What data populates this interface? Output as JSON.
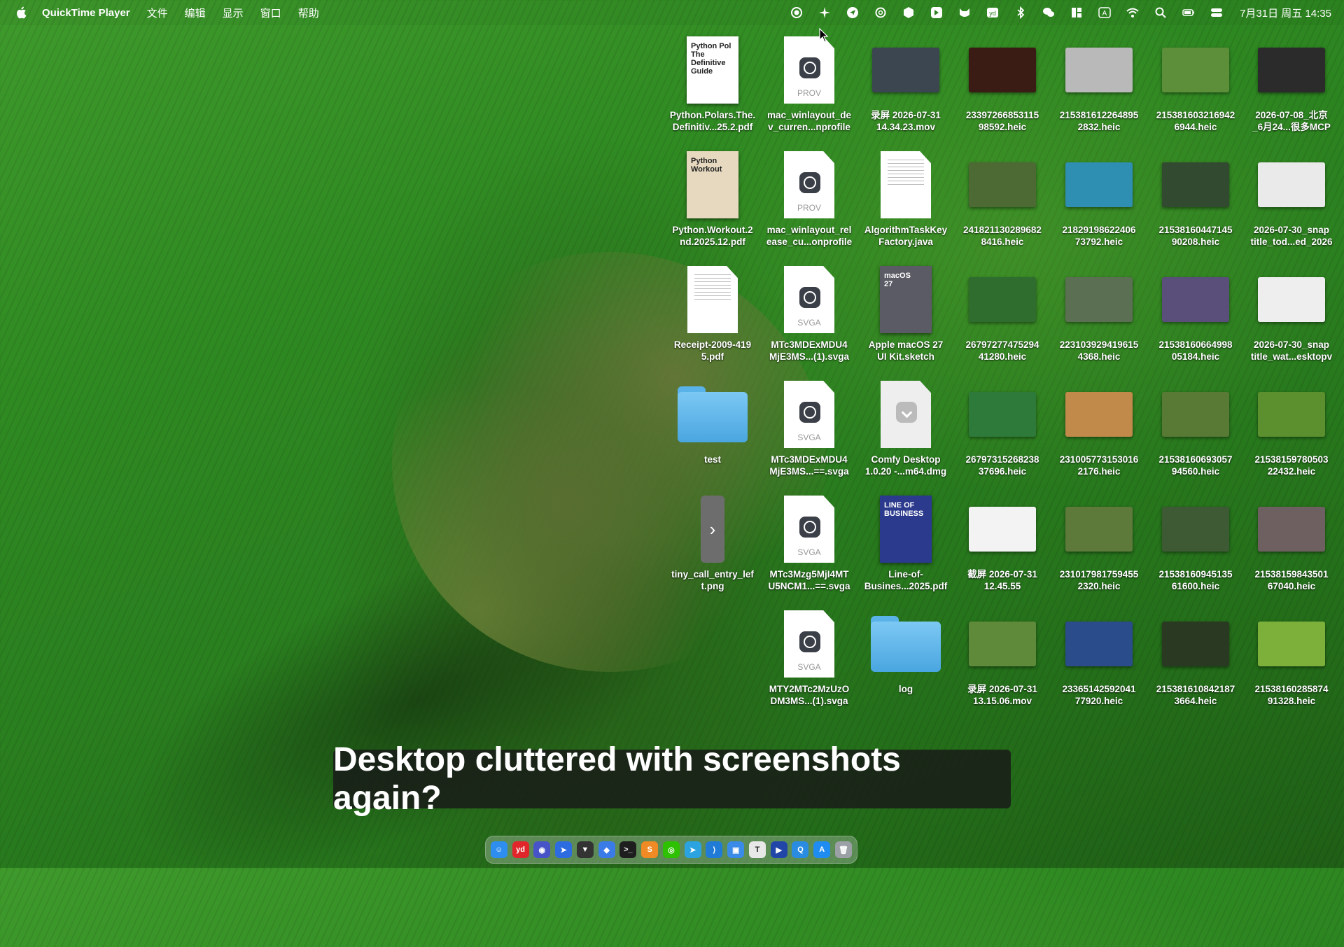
{
  "menubar": {
    "app_name": "QuickTime Player",
    "menus": [
      "文件",
      "编辑",
      "显示",
      "窗口",
      "帮助"
    ],
    "input_method": "A",
    "clock": "7月31日 周五  14:35"
  },
  "desktop_icons": [
    {
      "label": "Python.Polars.The.\nDefinitiv...25.2.pdf",
      "kind": "cover",
      "cover_title": "Python Pol\nThe Definitive Guide",
      "color": "#ffffff"
    },
    {
      "label": "mac_winlayout_de\nv_curren...nprofile",
      "kind": "doc-badge",
      "cap": "PROV"
    },
    {
      "label": "录屏 2026-07-31\n14.34.23.mov",
      "kind": "photo",
      "color": "#3b4650"
    },
    {
      "label": "23397266853115\n98592.heic",
      "kind": "photo",
      "color": "#3a1c14"
    },
    {
      "label": "215381612264895\n2832.heic",
      "kind": "photo",
      "color": "#b9b9b9"
    },
    {
      "label": "215381603216942\n6944.heic",
      "kind": "photo",
      "color": "#5d8f3a"
    },
    {
      "label": "2026-07-08_北京\n_6月24...很多MCP",
      "kind": "photo",
      "color": "#2b2b2b"
    },
    {
      "label": "Python.Workout.2\nnd.2025.12.pdf",
      "kind": "cover",
      "cover_title": "Python\nWorkout",
      "color": "#e7d9bf"
    },
    {
      "label": "mac_winlayout_rel\nease_cu...onprofile",
      "kind": "doc-badge",
      "cap": "PROV"
    },
    {
      "label": "AlgorithmTaskKey\nFactory.java",
      "kind": "doc-lines",
      "cap": ""
    },
    {
      "label": "241821130289682\n8416.heic",
      "kind": "photo",
      "color": "#4d6a34"
    },
    {
      "label": "21829198622406\n73792.heic",
      "kind": "photo",
      "color": "#2f8fb3"
    },
    {
      "label": "21538160447145\n90208.heic",
      "kind": "photo",
      "color": "#324a30"
    },
    {
      "label": "2026-07-30_snap\ntitle_tod...ed_2026",
      "kind": "photo",
      "color": "#eaeaea"
    },
    {
      "label": "Receipt-2009-419\n5.pdf",
      "kind": "doc-lines",
      "cap": ""
    },
    {
      "label": "MTc3MDExMDU4\nMjE3MS...(1).svga",
      "kind": "doc-badge",
      "cap": "SVGA"
    },
    {
      "label": "Apple macOS 27\nUI Kit.sketch",
      "kind": "cover",
      "cover_title": "macOS\n27",
      "color": "#5b5b66"
    },
    {
      "label": "26797277475294\n41280.heic",
      "kind": "photo",
      "color": "#2f6d2f"
    },
    {
      "label": "223103929419615\n4368.heic",
      "kind": "photo",
      "color": "#5b6f52"
    },
    {
      "label": "21538160664998\n05184.heic",
      "kind": "photo",
      "color": "#5a4f7a"
    },
    {
      "label": "2026-07-30_snap\ntitle_wat...esktopv",
      "kind": "photo",
      "color": "#eeeeee"
    },
    {
      "label": "test",
      "kind": "folder"
    },
    {
      "label": "MTc3MDExMDU4\nMjE3MS...==.svga",
      "kind": "doc-badge",
      "cap": "SVGA"
    },
    {
      "label": "Comfy Desktop\n1.0.20 -...m64.dmg",
      "kind": "doc-dmg",
      "cap": ""
    },
    {
      "label": "26797315268238\n37696.heic",
      "kind": "photo",
      "color": "#2e7a3a"
    },
    {
      "label": "231005773153016\n2176.heic",
      "kind": "photo",
      "color": "#c28a4a"
    },
    {
      "label": "21538160693057\n94560.heic",
      "kind": "photo",
      "color": "#597a35"
    },
    {
      "label": "21538159780503\n22432.heic",
      "kind": "photo",
      "color": "#5c8f2e"
    },
    {
      "label": "tiny_call_entry_lef\nt.png",
      "kind": "side-panel",
      "glyph": "›"
    },
    {
      "label": "MTc3Mzg5MjI4MT\nU5NCM1...==.svga",
      "kind": "doc-badge",
      "cap": "SVGA"
    },
    {
      "label": "Line-of-\nBusines...2025.pdf",
      "kind": "cover",
      "cover_title": "LINE OF\nBUSINESS",
      "color": "#2b3a8c"
    },
    {
      "label": "截屏 2026-07-31\n12.45.55",
      "kind": "photo",
      "color": "#f3f3f3"
    },
    {
      "label": "231017981759455\n2320.heic",
      "kind": "photo",
      "color": "#5d7a3a"
    },
    {
      "label": "21538160945135\n61600.heic",
      "kind": "photo",
      "color": "#3d5a35"
    },
    {
      "label": "21538159843501\n67040.heic",
      "kind": "photo",
      "color": "#6e6060"
    },
    {
      "label": "",
      "kind": "empty"
    },
    {
      "label": "MTY2MTc2MzUzO\nDM3MS...(1).svga",
      "kind": "doc-badge",
      "cap": "SVGA"
    },
    {
      "label": "log",
      "kind": "folder"
    },
    {
      "label": "录屏 2026-07-31\n13.15.06.mov",
      "kind": "photo",
      "color": "#5f8a3a"
    },
    {
      "label": "23365142592041\n77920.heic",
      "kind": "photo",
      "color": "#2b4c8a"
    },
    {
      "label": "215381610842187\n3664.heic",
      "kind": "photo",
      "color": "#2a3a22"
    },
    {
      "label": "21538160285874\n91328.heic",
      "kind": "photo",
      "color": "#7db03a"
    }
  ],
  "caption": "Desktop cluttered with screenshots again?",
  "dock": [
    {
      "name": "finder",
      "color": "#2d8ef0",
      "glyph": "☺"
    },
    {
      "name": "youdao",
      "color": "#e0262a",
      "glyph": "yd"
    },
    {
      "name": "app-3",
      "color": "#4654c8",
      "glyph": "◉"
    },
    {
      "name": "app-4",
      "color": "#2c6be0",
      "glyph": "➤"
    },
    {
      "name": "app-5",
      "color": "#333333",
      "glyph": "▼"
    },
    {
      "name": "app-6",
      "color": "#3a7be8",
      "glyph": "◆"
    },
    {
      "name": "terminal",
      "color": "#1e1e1e",
      "glyph": ">_"
    },
    {
      "name": "sublime",
      "color": "#f08a24",
      "glyph": "S"
    },
    {
      "name": "wechat",
      "color": "#2dc100",
      "glyph": "◎"
    },
    {
      "name": "telegram",
      "color": "#2aa3e0",
      "glyph": "➤"
    },
    {
      "name": "vscode",
      "color": "#1f7bd6",
      "glyph": "⟩"
    },
    {
      "name": "app-12",
      "color": "#3a8be8",
      "glyph": "▣"
    },
    {
      "name": "typora",
      "color": "#e8e8e8",
      "glyph": "T"
    },
    {
      "name": "app-14",
      "color": "#2246a8",
      "glyph": "▶"
    },
    {
      "name": "app-15",
      "color": "#2a8ce0",
      "glyph": "Q"
    },
    {
      "name": "app-store",
      "color": "#1e8cf0",
      "glyph": "A"
    },
    {
      "name": "trash",
      "color": "#9aa0a6",
      "glyph": "🗑"
    }
  ]
}
